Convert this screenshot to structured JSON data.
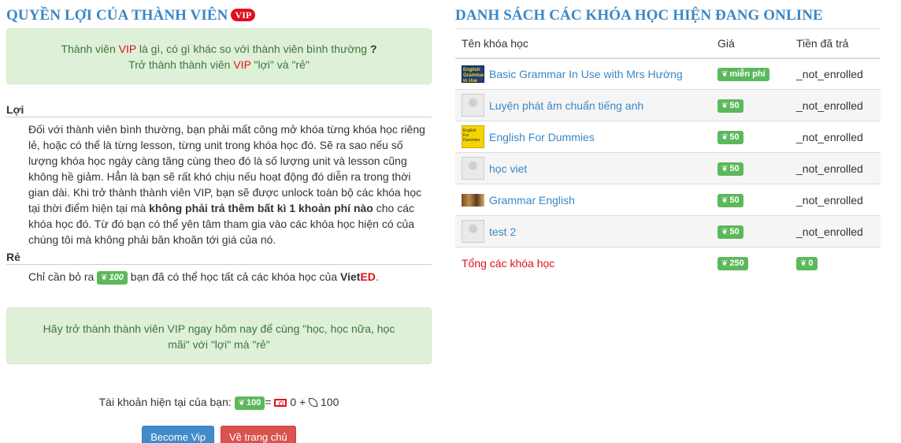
{
  "left": {
    "title": "Quyền lợi của thành viên",
    "vip_badge": "VIP",
    "top_alert": {
      "line1_pre": "Thành viên ",
      "line1_vip": "VIP",
      "line1_post": " là gì, có gì khác so với thành viên bình thường ",
      "line1_q": "?",
      "line2_pre": "Trở thành thành viên ",
      "line2_vip": "VIP",
      "line2_post": " \"lợi\" và \"rẻ\""
    },
    "loi": {
      "heading": "Lợi",
      "text_pre": "Đối với thành viên bình thường, bạn phải mất công mở khóa từng khóa học riêng lẻ, hoặc có thể là từng lesson, từng unit trong khóa học đó. Sẽ ra sao nếu số lượng khóa học ngày càng tăng cùng theo đó là số lượng unit và lesson cũng không hề giảm. Hẳn là bạn sẽ rất khó chịu nếu hoạt động đó diễn ra trong thời gian dài. Khi trở thành thành viên VIP, bạn sẽ được unlock toàn bộ các khóa học tại thời điểm hiện tại mà ",
      "text_bold": "không phải trả thêm bất kì 1 khoản phí nào",
      "text_post": " cho các khóa học đó. Từ đó bạn có thể yên tâm tham gia vào các khóa học hiện có của chúng tôi mà không phải băn khoăn tới giá của nó."
    },
    "re": {
      "heading": "Rẻ",
      "text_pre": "Chỉ cần bỏ ra ",
      "coin": "100",
      "text_post": " bạn đã có thể học tất cả các khóa học của ",
      "brand_a": "Viet",
      "brand_b": "ED",
      "brand_end": "."
    },
    "mid_alert": "Hãy trở thành thành viên VIP ngay hôm nay để cùng \"học, học nữa, học mãi\" với \"lợi\" mà \"rẻ\"",
    "account": {
      "label": "Tài khoản hiện tại của bạn: ",
      "coin": "100",
      "equals": "=",
      "cash": "0",
      "plus": "+",
      "free": "100"
    },
    "buttons": {
      "become_vip": "Become Vip",
      "home": "Về trang chủ"
    }
  },
  "right": {
    "title": "Danh sách các khóa học hiện đang online",
    "columns": [
      "Tên khóa học",
      "Giá",
      "Tiền đã trả"
    ],
    "rows": [
      {
        "name": "Basic Grammar In Use with Mrs Hường",
        "price": "miễn phí",
        "paid": "_not_enrolled",
        "thumb": "English Grammar in Use"
      },
      {
        "name": "Luyện phát âm chuẩn tiếng anh",
        "price": "50",
        "paid": "_not_enrolled",
        "thumb": ""
      },
      {
        "name": "English For Dummies",
        "price": "50",
        "paid": "_not_enrolled",
        "thumb": "English For Dummies"
      },
      {
        "name": "học viet",
        "price": "50",
        "paid": "_not_enrolled",
        "thumb": ""
      },
      {
        "name": "Grammar English",
        "price": "50",
        "paid": "_not_enrolled",
        "thumb": ""
      },
      {
        "name": "test 2",
        "price": "50",
        "paid": "_not_enrolled",
        "thumb": ""
      }
    ],
    "total": {
      "label": "Tổng các khóa học",
      "price": "250",
      "paid": "0"
    }
  },
  "colors": {
    "heading": "#3a87c6",
    "red": "#e0101a",
    "coin_green": "#5cb85c",
    "alert_bg": "#dff0d8",
    "alert_text": "#3c763d",
    "primary": "#428bca",
    "danger": "#d9534f"
  },
  "icons": {
    "coin": "leaf-icon",
    "cash": "money-bill-icon",
    "free": "leaf-outline-icon"
  }
}
